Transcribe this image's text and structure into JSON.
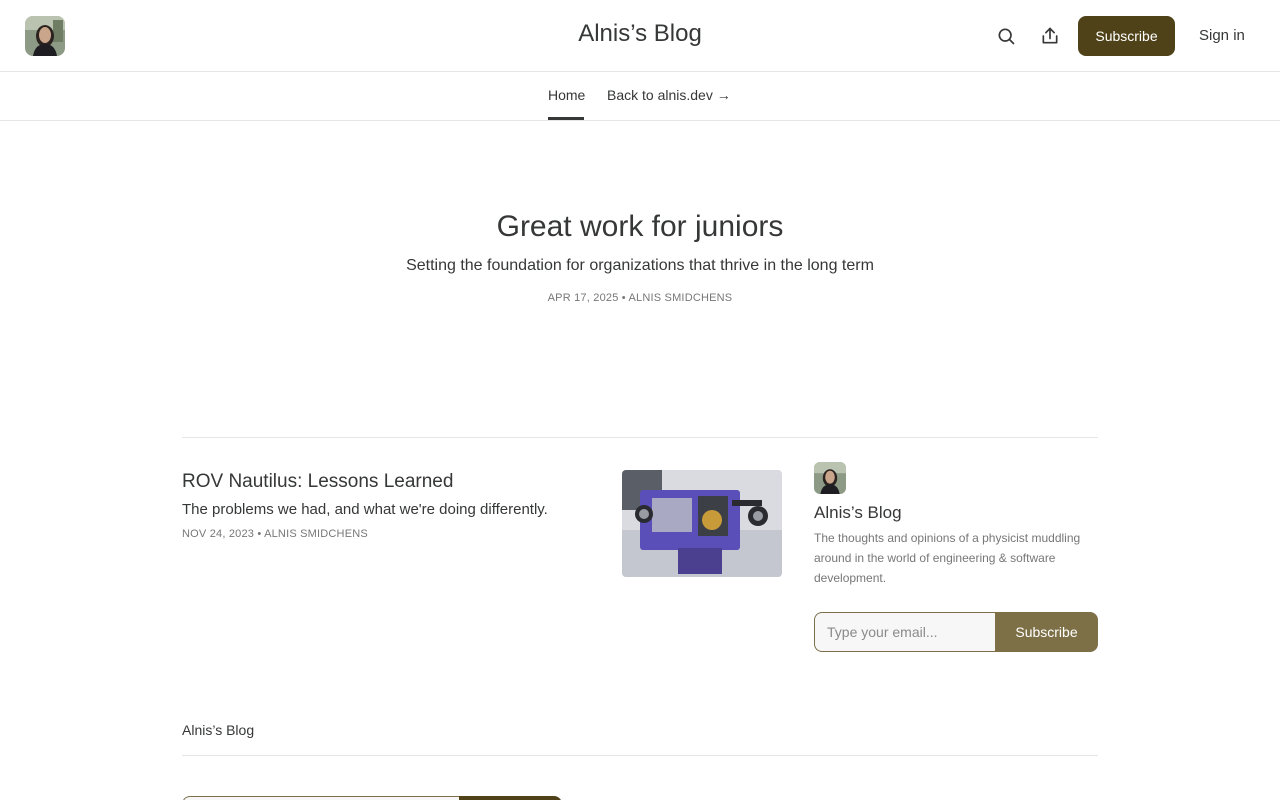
{
  "header": {
    "title": "Alnis’s Blog",
    "subscribe_label": "Subscribe",
    "signin_label": "Sign in"
  },
  "nav": {
    "tabs": [
      {
        "label": "Home",
        "active": true
      },
      {
        "label": "Back to alnis.dev →",
        "active": false
      }
    ]
  },
  "hero": {
    "title": "Great work for juniors",
    "subtitle": "Setting the foundation for organizations that thrive in the long term",
    "meta": "APR 17, 2025 • ALNIS SMIDCHENS"
  },
  "posts": [
    {
      "title": "ROV Nautilus: Lessons Learned",
      "subtitle": "The problems we had, and what we're doing differently.",
      "meta": "NOV 24, 2023 • ALNIS SMIDCHENS"
    }
  ],
  "sidebar": {
    "name": "Alnis’s Blog",
    "description": "The thoughts and opinions of a physicist muddling around in the world of engineering & software development.",
    "email_placeholder": "Type your email...",
    "subscribe_label": "Subscribe"
  },
  "footer": {
    "title": "Alnis’s Blog"
  },
  "colors": {
    "accent": "#4f4219",
    "accent_light": "#7d6f46",
    "text": "#363737",
    "muted": "#777777",
    "border": "#e6e6e6"
  },
  "icons": {
    "search": "search-icon",
    "share": "share-icon"
  }
}
